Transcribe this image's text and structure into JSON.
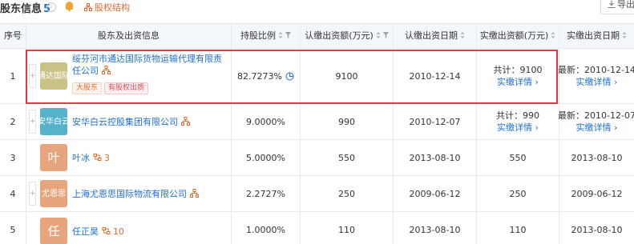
{
  "header": {
    "title": "股东信息",
    "count": "5",
    "info_glyph": "i",
    "equity_link": "股权结构",
    "export_label": "导出数据"
  },
  "table": {
    "columns": [
      {
        "label": "序号"
      },
      {
        "label": "股东及出资信息"
      },
      {
        "label": "持股比例"
      },
      {
        "label": "认缴出资额(万元)"
      },
      {
        "label": "认缴出资日期"
      },
      {
        "label": "实缴出资额(万元)"
      },
      {
        "label": "实缴出资日期"
      }
    ],
    "rows": [
      {
        "index": "1",
        "logo_text": "通达国际",
        "logo_color": "#c9c285",
        "name": "绥芬河市通达国际货物运输代理有限责任公司",
        "tags": [
          "大股东",
          "有股权出质"
        ],
        "ratio": "82.7273%",
        "subscribed_amount": "9100",
        "subscribed_date": "2010-12-14",
        "paid_total": "共计：9100",
        "paid_detail": "实缴详情",
        "paid_date": "最新：2010-12-14",
        "paid_date_detail": "实缴详情"
      },
      {
        "index": "2",
        "logo_text": "安华白云",
        "logo_color": "#55b3c9",
        "name": "安华白云控股集团有限公司",
        "ratio": "9.0000%",
        "subscribed_amount": "990",
        "subscribed_date": "2010-12-07",
        "paid_total": "共计：990",
        "paid_detail": "实缴详情",
        "paid_date": "最新：2010-12-07",
        "paid_date_detail": "实缴详情"
      },
      {
        "index": "3",
        "logo_text": "叶",
        "logo_color": "#e7a57d",
        "name": "叶冰",
        "person_count": "3",
        "ratio": "5.0000%",
        "subscribed_amount": "550",
        "subscribed_date": "2013-08-10",
        "paid_amount": "550",
        "paid_date": "2013-08-10"
      },
      {
        "index": "4",
        "logo_text": "尤恩思",
        "logo_color": "#e7a57d",
        "name": "上海尤恩思国际物流有限公司",
        "ratio": "2.2727%",
        "subscribed_amount": "250",
        "subscribed_date": "2009-06-12",
        "paid_amount": "250",
        "paid_date": "2009-06-12"
      },
      {
        "index": "5",
        "logo_text": "任",
        "logo_color": "#e7a57d",
        "name": "任正昊",
        "person_count": "10",
        "ratio": "1.0000%",
        "subscribed_amount": "110",
        "subscribed_date": "2013-08-10",
        "paid_amount": "110",
        "paid_date": "2013-08-10"
      }
    ]
  },
  "colors": {
    "accent_blue": "#1f6fd1",
    "accent_orange": "#e26a2c",
    "highlight_red": "#e8383f",
    "header_bg": "#f3f6fa"
  }
}
